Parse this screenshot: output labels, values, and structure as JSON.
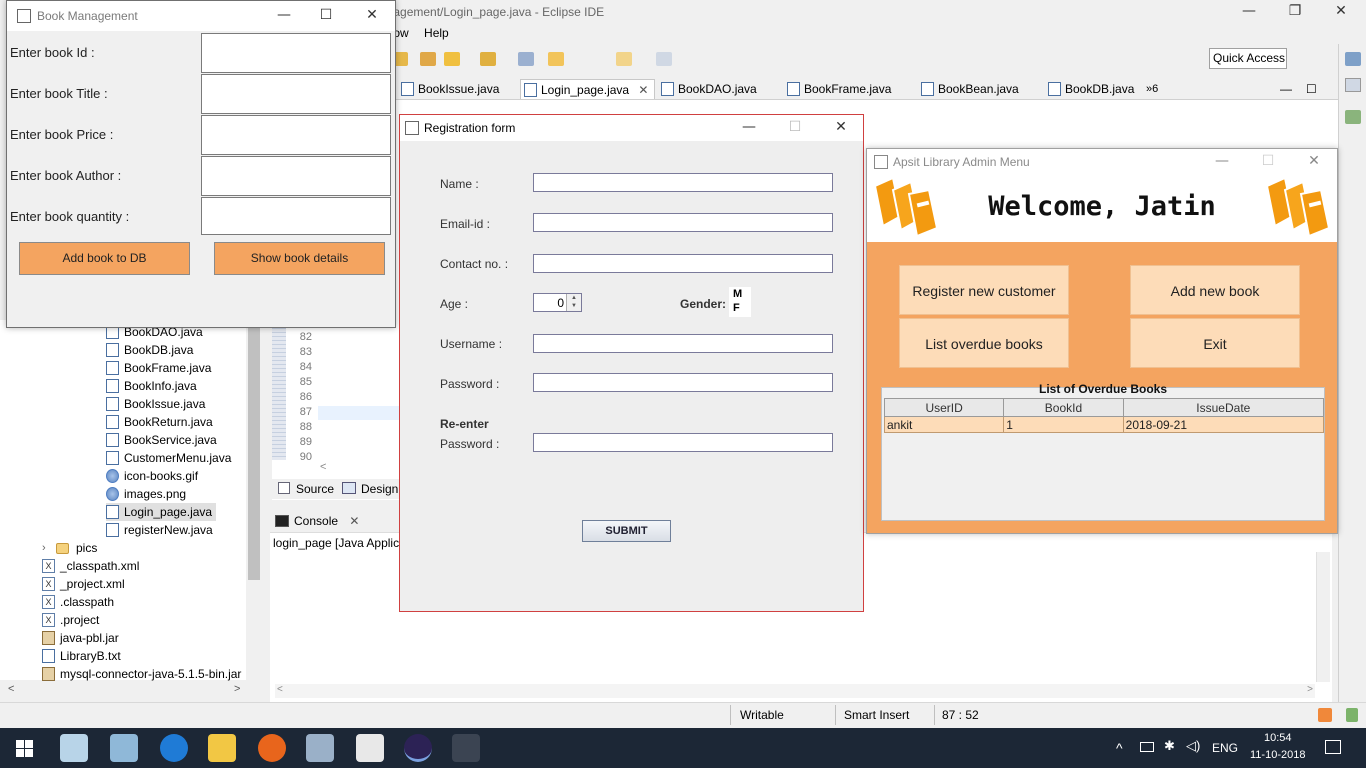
{
  "eclipse": {
    "title": "anagement/Login_page.java - Eclipse IDE",
    "menu_window": "ndow",
    "menu_help": "Help",
    "quick_access": "Quick Access",
    "editor_tabs": [
      "BookIssue.java",
      "Login_page.java",
      "BookDAO.java",
      "BookFrame.java",
      "BookBean.java",
      "BookDB.java"
    ],
    "more_tabs": "»6",
    "line_numbers": [
      "82",
      "83",
      "84",
      "85",
      "86",
      "87",
      "88",
      "89",
      "90"
    ],
    "source_tab": "Source",
    "design_tab": "Design",
    "console_tab": "Console",
    "console_line": "login_page [Java Applica",
    "status": {
      "writable": "Writable",
      "insert_mode": "Smart Insert",
      "position": "87 : 52"
    }
  },
  "package_explorer": {
    "items": [
      {
        "label": "BookDAO.java",
        "type": "java"
      },
      {
        "label": "BookDB.java",
        "type": "java"
      },
      {
        "label": "BookFrame.java",
        "type": "java"
      },
      {
        "label": "BookInfo.java",
        "type": "java"
      },
      {
        "label": "BookIssue.java",
        "type": "java"
      },
      {
        "label": "BookReturn.java",
        "type": "java"
      },
      {
        "label": "BookService.java",
        "type": "java"
      },
      {
        "label": "CustomerMenu.java",
        "type": "java"
      },
      {
        "label": "icon-books.gif",
        "type": "image"
      },
      {
        "label": "images.png",
        "type": "image"
      },
      {
        "label": "Login_page.java",
        "type": "java"
      },
      {
        "label": "registerNew.java",
        "type": "java"
      },
      {
        "label": "pics",
        "type": "folder"
      },
      {
        "label": "_classpath.xml",
        "type": "xml"
      },
      {
        "label": "_project.xml",
        "type": "xml"
      },
      {
        "label": ".classpath",
        "type": "xml"
      },
      {
        "label": ".project",
        "type": "xml"
      },
      {
        "label": "java-pbl.jar",
        "type": "jar"
      },
      {
        "label": "LibraryB.txt",
        "type": "text"
      },
      {
        "label": "mysql-connector-java-5.1.5-bin.jar",
        "type": "jar"
      }
    ]
  },
  "book_management": {
    "title": "Book Management",
    "labels": [
      "Enter book Id :",
      "Enter book Title :",
      "Enter book Price :",
      "Enter book Author :",
      "Enter book quantity :"
    ],
    "add_button": "Add book to DB",
    "show_button": "Show book details"
  },
  "registration": {
    "title": "Registration form",
    "name_label": "Name :",
    "email_label": "Email-id :",
    "contact_label": "Contact no. :",
    "age_label": "Age :",
    "age_value": "0",
    "gender_label": "Gender:",
    "gender_options": [
      "M",
      "F"
    ],
    "username_label": "Username :",
    "password_label": "Password :",
    "reenter_label_1": "Re-enter",
    "reenter_label_2": "Password :",
    "submit": "SUBMIT"
  },
  "admin_menu": {
    "title": "Apsit Library Admin Menu",
    "welcome": "Welcome, Jatin",
    "buttons": {
      "register": "Register new customer",
      "add_book": "Add new book",
      "list_overdue": "List overdue books",
      "exit": "Exit"
    },
    "overdue_title": "List of Overdue Books",
    "table": {
      "headers": [
        "UserID",
        "BookId",
        "IssueDate"
      ],
      "rows": [
        [
          "ankit",
          "1",
          "2018-09-21"
        ]
      ]
    }
  },
  "taskbar": {
    "lang": "ENG",
    "time": "10:54",
    "date": "11-10-2018"
  },
  "colors": {
    "accent_orange": "#f4a460",
    "button_peach": "#fddcb8",
    "taskbar_bg": "#1c2736"
  }
}
